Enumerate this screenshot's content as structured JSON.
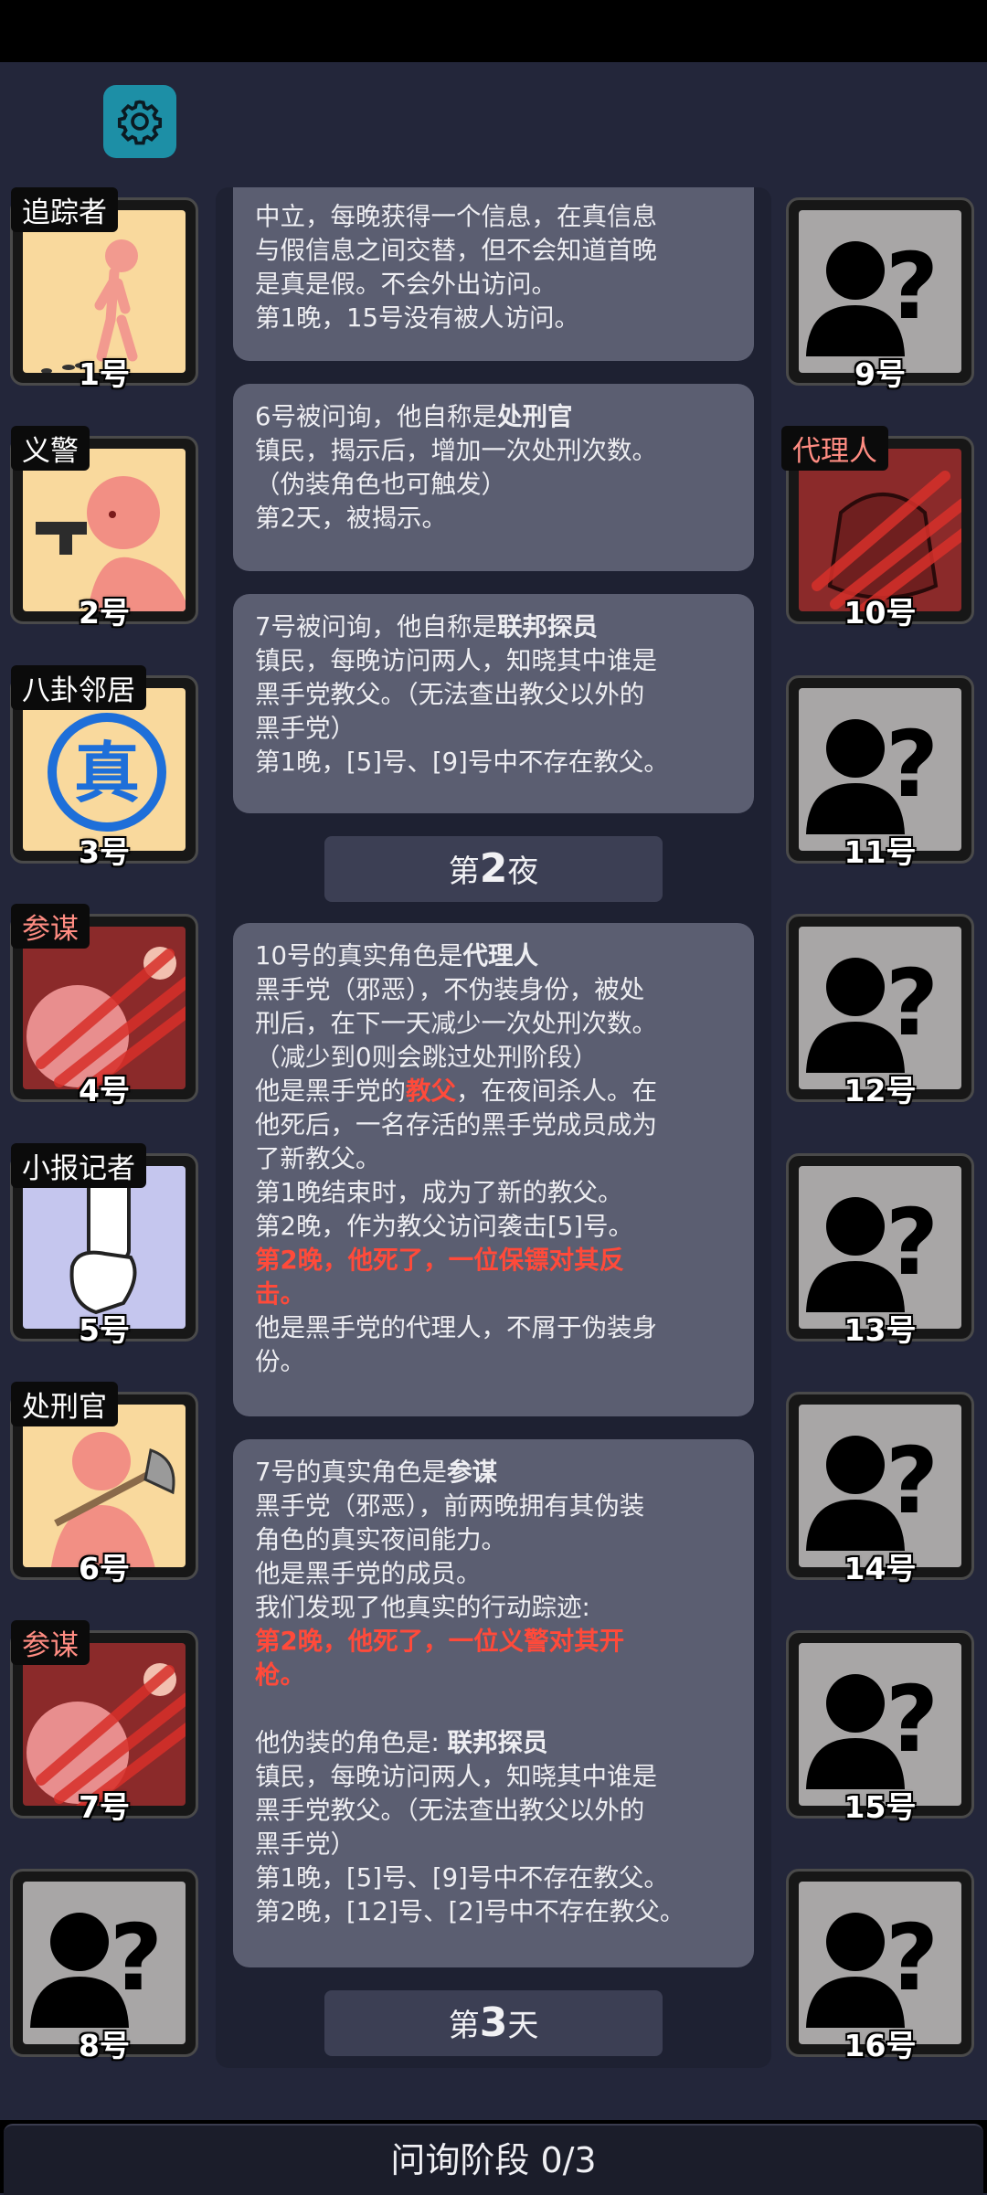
{
  "players_left": [
    {
      "number": "1号",
      "role": "追踪者"
    },
    {
      "number": "2号",
      "role": "义警"
    },
    {
      "number": "3号",
      "role": "八卦邻居"
    },
    {
      "number": "4号",
      "role": "参谋"
    },
    {
      "number": "5号",
      "role": "小报记者"
    },
    {
      "number": "6号",
      "role": "处刑官"
    },
    {
      "number": "7号",
      "role": "参谋"
    },
    {
      "number": "8号",
      "role": ""
    }
  ],
  "players_right": [
    {
      "number": "9号",
      "role": ""
    },
    {
      "number": "10号",
      "role": "代理人"
    },
    {
      "number": "11号",
      "role": ""
    },
    {
      "number": "12号",
      "role": ""
    },
    {
      "number": "13号",
      "role": ""
    },
    {
      "number": "14号",
      "role": ""
    },
    {
      "number": "15号",
      "role": ""
    },
    {
      "number": "16号",
      "role": ""
    }
  ],
  "log": {
    "b1": {
      "line1": "中立，每晚获得一个信息，在真信息",
      "line2": "与假信息之间交替，但不会知道首晚",
      "line3": "是真是假。不会外出访问。",
      "line4": "第1晚，15号没有被人访问。"
    },
    "b2": {
      "pre": "6号被问询，他自称是",
      "role": "处刑官",
      "line2": "镇民，揭示后，增加一次处刑次数。",
      "line3": "（伪装角色也可触发）",
      "line4": "第2天，被揭示。"
    },
    "b3": {
      "pre": "7号被问询，他自称是",
      "role": "联邦探员",
      "line2": "镇民，每晚访问两人，知晓其中谁是",
      "line3": "黑手党教父。（无法查出教父以外的",
      "line4": "黑手党）",
      "line5": "第1晚，[5]号、[9]号中不存在教父。"
    },
    "night2": {
      "pre": "第",
      "num": "2",
      "post": "夜"
    },
    "b4": {
      "pre": "10号的真实角色是",
      "role": "代理人",
      "line2": "黑手党（邪恶），不伪装身份，被处",
      "line3": "刑后，在下一天减少一次处刑次数。",
      "line4": "（减少到0则会跳过处刑阶段）",
      "line5_pre": "他是黑手党的",
      "line5_red": "教父",
      "line5_post": "，在夜间杀人。在",
      "line6": "他死后，一名存活的黑手党成员成为",
      "line7": "了新教父。",
      "line8": "第1晚结束时，成为了新的教父。",
      "line9": "第2晚，作为教父访问袭击[5]号。",
      "line10": "第2晚，他死了，一位保镖对其反",
      "line11": "击。",
      "line12": "他是黑手党的代理人，不屑于伪装身",
      "line13": "份。"
    },
    "b5": {
      "pre": "7号的真实角色是",
      "role": "参谋",
      "line2": "黑手党（邪恶），前两晚拥有其伪装",
      "line3": "角色的真实夜间能力。",
      "line4": "他是黑手党的成员。",
      "line5": "我们发现了他真实的行动踪迹:",
      "line6": "第2晚，他死了，一位义警对其开",
      "line7": "枪。",
      "line8_pre": "他伪装的角色是: ",
      "line8_role": "联邦探员",
      "line9": "镇民，每晚访问两人，知晓其中谁是",
      "line10": "黑手党教父。（无法查出教父以外的",
      "line11": "黑手党）",
      "line12": "第1晚，[5]号、[9]号中不存在教父。",
      "line13": "第2晚，[12]号、[2]号中不存在教父。"
    },
    "day3": {
      "pre": "第",
      "num": "3",
      "post": "天"
    }
  },
  "phase": "问询阶段 0/3",
  "icons": {
    "settings": "gear-icon",
    "unknown": "unknown-person-icon"
  },
  "colors": {
    "background": "#23263a",
    "bubble": "#5b5e71",
    "death_text": "#ff4a3a",
    "role_tag_evil": "#ff8c82"
  }
}
